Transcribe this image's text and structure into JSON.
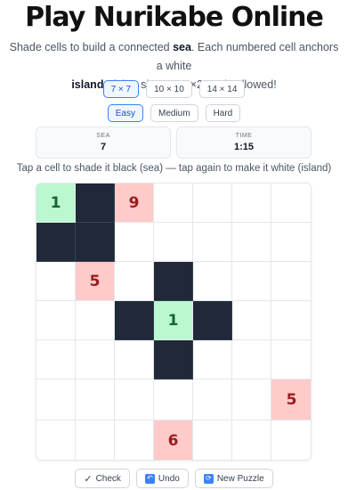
{
  "title": "Play Nurikabe Online",
  "subtitle": {
    "pre": "Shade cells to build a connected ",
    "sea_word": "sea",
    "mid": ". Each numbered cell anchors a white ",
    "island_word": "island",
    "post": " of that size. No 2×2 pools allowed!"
  },
  "sizes": [
    {
      "label": "7 × 7",
      "active": true
    },
    {
      "label": "10 × 10",
      "active": false
    },
    {
      "label": "14 × 14",
      "active": false
    }
  ],
  "difficulties": [
    {
      "label": "Easy",
      "active": true
    },
    {
      "label": "Medium",
      "active": false
    },
    {
      "label": "Hard",
      "active": false
    }
  ],
  "stats": {
    "sea_label": "SEA",
    "sea_value": "7",
    "time_label": "TIME",
    "time_value": "1:15"
  },
  "hint": "Tap a cell to shade it black (sea) — tap again to make it white (island)",
  "grid": [
    [
      "1",
      "#",
      "9",
      ".",
      ".",
      ".",
      "."
    ],
    [
      "#",
      "#",
      ".",
      ".",
      ".",
      ".",
      "."
    ],
    [
      ".",
      "5",
      ".",
      "#",
      ".",
      ".",
      "."
    ],
    [
      ".",
      ".",
      "#",
      "1",
      "#",
      ".",
      "."
    ],
    [
      ".",
      ".",
      ".",
      "#",
      ".",
      ".",
      "."
    ],
    [
      ".",
      ".",
      ".",
      ".",
      ".",
      ".",
      "5"
    ],
    [
      ".",
      ".",
      ".",
      "6",
      ".",
      ".",
      "."
    ]
  ],
  "satisfied_clues": [
    [
      0,
      0
    ],
    [
      3,
      3
    ]
  ],
  "actions": {
    "check": "Check",
    "check_icon": "✓",
    "undo": "Undo",
    "undo_icon": "↶",
    "new": "New Puzzle",
    "new_icon": "⟳"
  },
  "colors": {
    "sea": "#1f2937",
    "clue_unsatisfied": "#fecaca",
    "clue_satisfied": "#bbf7d0",
    "accent": "#3b82f6"
  }
}
